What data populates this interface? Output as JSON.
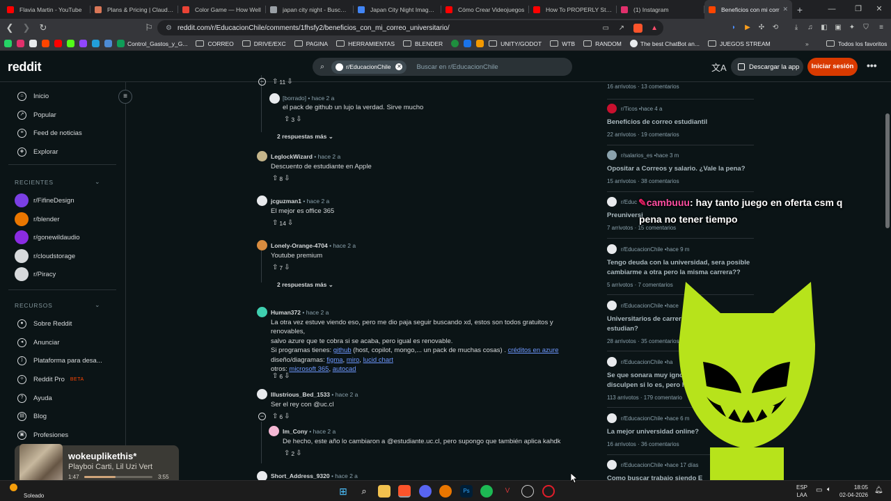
{
  "browser": {
    "tabs": [
      {
        "title": "Flavia Martin - YouTube",
        "color": "#ff0000"
      },
      {
        "title": "Plans & Pricing | Claude by",
        "color": "#d97757"
      },
      {
        "title": "Color Game — How Well",
        "color": "#ea4335"
      },
      {
        "title": "japan city night - Buscar c",
        "color": "#9aa0a6"
      },
      {
        "title": "Japan City Night Images - F",
        "color": "#4285f4"
      },
      {
        "title": "Cómo Crear Videojuegos",
        "color": "#ff0000"
      },
      {
        "title": "How To PROPERLY Start M",
        "color": "#ff0000"
      },
      {
        "title": "(1) Instagram",
        "color": "#e1306c"
      },
      {
        "title": "Beneficios con mi corr",
        "color": "#ff4500",
        "active": true
      }
    ],
    "url": "reddit.com/r/EducacionChile/comments/1fhsfy2/beneficios_con_mi_correo_universitario/",
    "bookmarks": [
      "Control_Gastos_y_G...",
      "CORREO",
      "DRIVE/EXC",
      "PAGINA",
      "HERRAMIENTAS",
      "BLENDER",
      "UNITY/GODOT",
      "WTB",
      "RANDOM",
      "The best ChatBot an...",
      "JUEGOS STREAM"
    ],
    "all_bookmarks": "Todos los favoritos"
  },
  "header": {
    "logo": "reddit",
    "search_chip": "r/EducacionChile",
    "search_placeholder": "Buscar en r/EducacionChile",
    "get_app": "Descargar la app",
    "login": "Iniciar sesión"
  },
  "sidebar": {
    "nav": [
      "Inicio",
      "Popular",
      "Feed de noticias",
      "Explorar"
    ],
    "recent_title": "RECIENTES",
    "recent": [
      {
        "name": "r/FifineDesign",
        "color": "#7b3fe4"
      },
      {
        "name": "r/blender",
        "color": "#ea7600"
      },
      {
        "name": "r/gonewildaudio",
        "color": "#8a2be2"
      },
      {
        "name": "r/cloudstorage",
        "color": "#d7dadc"
      },
      {
        "name": "r/Piracy",
        "color": "#d7dadc"
      }
    ],
    "resources_title": "RECURSOS",
    "resources": [
      "Sobre Reddit",
      "Anunciar",
      "Plataforma para desa...",
      "Reddit Pro",
      "Ayuda",
      "Blog",
      "Profesiones"
    ],
    "beta": "BETA"
  },
  "comments": [
    {
      "votes": "11"
    },
    {
      "author": "[borrado]",
      "time": "hace 2 a",
      "text": "el pack de github un lujo la verdad. Sirve mucho",
      "votes": "3"
    },
    {
      "more": "2 respuestas más"
    },
    {
      "author": "LeglockWizard",
      "time": "hace 2 a",
      "text": "Descuento de estudiante en Apple",
      "votes": "8"
    },
    {
      "author": "jcguzman1",
      "time": "hace 2 a",
      "text": "El mejor es office 365",
      "votes": "14"
    },
    {
      "author": "Lonely-Orange-4704",
      "time": "hace 2 a",
      "text": "Youtube premium",
      "votes": "7"
    },
    {
      "more": "2 respuestas más"
    },
    {
      "author": "Human372",
      "time": "hace 2 a",
      "text_l1": "La otra vez estuve viendo eso, pero me dio paja seguir buscando xd, estos son todos gratuitos y renovables,",
      "text_l2": "salvo azure que te cobra si se acaba, pero igual es renovable.",
      "l3_a": "Si programas tienes: ",
      "l3_link1": "github",
      "l3_b": " (host, copilot, mongo,... un pack de muchas cosas) . ",
      "l3_link2": "créditos en azure",
      "l4_a": "diseño/diagramas: ",
      "l4_link1": "figma",
      "l4_sep1": ", ",
      "l4_link2": "miro",
      "l4_sep2": ", ",
      "l4_link3": "lucid chart",
      "l5_a": "otros: ",
      "l5_link1": "microsoft 365",
      "l5_sep": ", ",
      "l5_link2": "autocad",
      "votes": "6"
    },
    {
      "author": "Illustrious_Bed_1533",
      "time": "hace 2 a",
      "text": "Ser el rey con @uc.cl",
      "votes": "6"
    },
    {
      "author": "Im_Cony",
      "time": "hace 2 a",
      "text": "De hecho, este año lo cambiaron a @estudiante.uc.cl, pero supongo que también aplica kahdk",
      "votes": "2"
    },
    {
      "author": "Short_Address_9320",
      "time": "hace 2 a"
    }
  ],
  "related": [
    {
      "stats_a": "16 arrivotos",
      "stats_b": "13 comentarios"
    },
    {
      "sub": "r/Ticos",
      "time": "hace 4 a",
      "title": "Beneficios de correo estudiantil",
      "stats_a": "22 arrivotos",
      "stats_b": "19 comentarios"
    },
    {
      "sub": "r/salarios_es",
      "time": "hace 3 m",
      "title": "Opositar a Correos y salario. ¿Vale la pena?",
      "stats_a": "15 arrivotos",
      "stats_b": "38 comentarios"
    },
    {
      "sub": "r/Educ",
      "title": "Preuniversi",
      "stats_a": "7 arrivotos",
      "stats_b": "15 comentarios"
    },
    {
      "sub": "r/EducacionChile",
      "time": "hace 9 m",
      "title": "Tengo deuda con la universidad, sera posible cambiarme a otra pero la misma carrera??",
      "stats_a": "5 arrivotos",
      "stats_b": "7 comentarios"
    },
    {
      "sub": "r/EducacionChile",
      "time": "hace",
      "title": "Universitarios de carreras estudian?",
      "stats_a": "28 arrivotos",
      "stats_b": "35 comentarios"
    },
    {
      "sub": "r/EducacionChile",
      "time": "ha",
      "title": "Se que sonara muy igno disculpen si lo es, pero h",
      "stats_a": "113 arrivotos",
      "stats_b": "179 comentario"
    },
    {
      "sub": "r/EducacionChile",
      "time": "hace 6 m",
      "title": "La mejor universidad online?",
      "stats_a": "16 arrivotos",
      "stats_b": "36 comentarios"
    },
    {
      "sub": "r/EducacionChile",
      "time": "hace 17 días",
      "title": "Como buscar trabajo siendo E"
    }
  ],
  "overlay": {
    "user": "cambuuu",
    "message_l1": ":  hay tanto juego en oferta csm q",
    "message_l2": "pena no tener tiempo"
  },
  "music": {
    "title": "wokeuplikethis*",
    "artist": "Playboi Carti, Lil Uzi Vert",
    "elapsed": "1:47",
    "total": "3:55",
    "progress": 0.455
  },
  "taskbar": {
    "weather_temp": "",
    "weather": "Soleado",
    "lang": "ESP",
    "lang2": "LAA",
    "time": "18:05",
    "date": "02-04-2026"
  }
}
